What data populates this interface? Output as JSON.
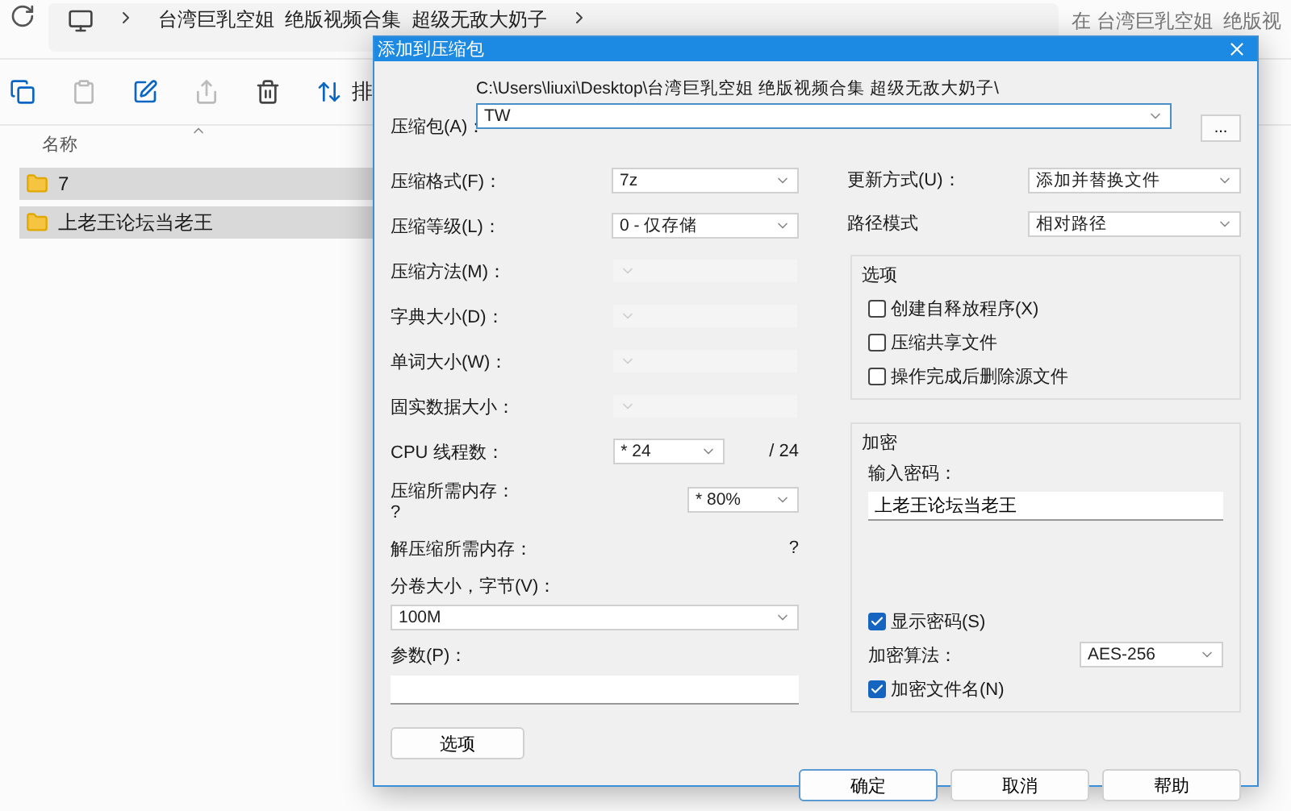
{
  "explorer": {
    "address_path": "台湾巨乳空姐  绝版视频合集  超级无敌大奶子",
    "search_placeholder": "在 台湾巨乳空姐  绝版视",
    "toolbar_label": "排",
    "column_header": "名称",
    "items": [
      {
        "name": "7",
        "selected": true
      },
      {
        "name": "上老王论坛当老王",
        "selected": true
      }
    ]
  },
  "dialog": {
    "title": "添加到压缩包",
    "archive": {
      "label": "压缩包(A)：",
      "path": "C:\\Users\\liuxi\\Desktop\\台湾巨乳空姐  绝版视频合集  超级无敌大奶子\\",
      "value": "TW",
      "browse": "..."
    },
    "left_rows": [
      {
        "kind": "combo",
        "label": "压缩格式(F)：",
        "value": "7z",
        "disabled": false
      },
      {
        "kind": "combo",
        "label": "压缩等级(L)：",
        "value": "0 - 仅存储",
        "disabled": false
      },
      {
        "kind": "combo",
        "label": "压缩方法(M)：",
        "disabled": true
      },
      {
        "kind": "combo",
        "label": "字典大小(D)：",
        "disabled": true
      },
      {
        "kind": "combo",
        "label": "单词大小(W)：",
        "disabled": true
      },
      {
        "kind": "combo",
        "label": "固实数据大小：",
        "disabled": true
      },
      {
        "kind": "threads",
        "label": "CPU 线程数：",
        "value": "* 24",
        "suffix": "/ 24"
      },
      {
        "kind": "memory",
        "label": "压缩所需内存：",
        "note": "?",
        "value": "* 80%"
      },
      {
        "kind": "info",
        "label": "解压缩所需内存：",
        "note": "?"
      }
    ],
    "volume": {
      "label": "分卷大小，字节(V)：",
      "value": "100M"
    },
    "params": {
      "label": "参数(P)："
    },
    "options_button": "选项",
    "right_rows": [
      {
        "label": "更新方式(U)：",
        "value": "添加并替换文件"
      },
      {
        "label": "路径模式",
        "value": "相对路径"
      }
    ],
    "options_group": {
      "title": "选项",
      "items": [
        {
          "label": "创建自释放程序(X)",
          "checked": false
        },
        {
          "label": "压缩共享文件",
          "checked": false
        },
        {
          "label": "操作完成后删除源文件",
          "checked": false
        }
      ]
    },
    "encryption": {
      "title": "加密",
      "password_label": "输入密码：",
      "password": "上老王论坛当老王",
      "show_password": {
        "label": "显示密码(S)",
        "checked": true
      },
      "method_label": "加密算法：",
      "method": "AES-256",
      "encrypt_names": {
        "label": "加密文件名(N)",
        "checked": true
      }
    },
    "buttons": [
      {
        "label": "确定",
        "default": true
      },
      {
        "label": "取消",
        "default": false
      },
      {
        "label": "帮助",
        "default": false
      }
    ]
  }
}
